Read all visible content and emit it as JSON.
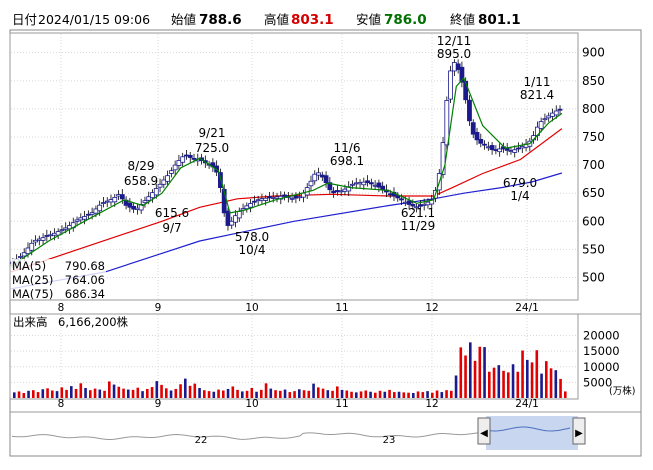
{
  "header": {
    "date_label": "日付",
    "date_value": "2024/01/15 09:06",
    "open_label": "始値",
    "open_value": "788.6",
    "high_label": "高値",
    "high_value": "803.1",
    "low_label": "安値",
    "low_value": "786.0",
    "close_label": "終値",
    "close_value": "801.1",
    "high_color": "#d40000",
    "low_color": "#007000"
  },
  "chart_data": [
    {
      "type": "candlestick",
      "title": "",
      "x_ticks": [
        "8",
        "9",
        "10",
        "11",
        "12",
        "24/1"
      ],
      "y_ticks": [
        500,
        550,
        600,
        650,
        700,
        750,
        800,
        850,
        900
      ],
      "ylim": [
        460,
        935
      ],
      "grid": true,
      "legend": [
        {
          "name": "MA(5)",
          "value": "790.68",
          "color": "#008000"
        },
        {
          "name": "MA(25)",
          "value": "764.06",
          "color": "#e00000"
        },
        {
          "name": "MA(75)",
          "value": "686.34",
          "color": "#2020d0"
        }
      ],
      "annotations": [
        {
          "label": "8/29",
          "value": "658.9"
        },
        {
          "label": "9/7",
          "value": "615.6"
        },
        {
          "label": "9/21",
          "value": "725.0"
        },
        {
          "label": "10/4",
          "value": "578.0"
        },
        {
          "label": "11/6",
          "value": "698.1"
        },
        {
          "label": "11/29",
          "value": "621.1"
        },
        {
          "label": "12/11",
          "value": "895.0"
        },
        {
          "label": "1/4",
          "value": "679.0"
        },
        {
          "label": "1/11",
          "value": "821.4"
        }
      ],
      "close_path": [
        [
          0,
          525
        ],
        [
          6,
          540
        ],
        [
          12,
          565
        ],
        [
          18,
          572
        ],
        [
          24,
          580
        ],
        [
          30,
          590
        ],
        [
          36,
          605
        ],
        [
          42,
          612
        ],
        [
          48,
          632
        ],
        [
          54,
          640
        ],
        [
          58,
          650
        ],
        [
          60,
          630
        ],
        [
          66,
          620
        ],
        [
          72,
          640
        ],
        [
          78,
          662
        ],
        [
          84,
          685
        ],
        [
          88,
          705
        ],
        [
          92,
          718
        ],
        [
          96,
          712
        ],
        [
          100,
          710
        ],
        [
          104,
          702
        ],
        [
          108,
          695
        ],
        [
          110,
          680
        ],
        [
          112,
          640
        ],
        [
          114,
          590
        ],
        [
          116,
          595
        ],
        [
          120,
          615
        ],
        [
          126,
          630
        ],
        [
          132,
          640
        ],
        [
          138,
          642
        ],
        [
          144,
          645
        ],
        [
          150,
          640
        ],
        [
          154,
          645
        ],
        [
          158,
          665
        ],
        [
          162,
          690
        ],
        [
          166,
          675
        ],
        [
          170,
          650
        ],
        [
          176,
          655
        ],
        [
          182,
          668
        ],
        [
          188,
          670
        ],
        [
          194,
          663
        ],
        [
          200,
          650
        ],
        [
          206,
          640
        ],
        [
          212,
          628
        ],
        [
          216,
          625
        ],
        [
          220,
          632
        ],
        [
          224,
          640
        ],
        [
          228,
          700
        ],
        [
          230,
          780
        ],
        [
          232,
          850
        ],
        [
          234,
          885
        ],
        [
          236,
          880
        ],
        [
          238,
          860
        ],
        [
          240,
          835
        ],
        [
          244,
          760
        ],
        [
          248,
          740
        ],
        [
          252,
          735
        ],
        [
          256,
          725
        ],
        [
          260,
          730
        ],
        [
          264,
          725
        ],
        [
          268,
          728
        ],
        [
          272,
          735
        ],
        [
          276,
          745
        ],
        [
          280,
          775
        ],
        [
          284,
          785
        ],
        [
          288,
          795
        ],
        [
          292,
          800
        ]
      ],
      "ma5_path": [
        [
          0,
          520
        ],
        [
          20,
          565
        ],
        [
          40,
          602
        ],
        [
          60,
          638
        ],
        [
          70,
          628
        ],
        [
          80,
          650
        ],
        [
          90,
          695
        ],
        [
          100,
          712
        ],
        [
          110,
          690
        ],
        [
          116,
          615
        ],
        [
          124,
          620
        ],
        [
          140,
          638
        ],
        [
          160,
          655
        ],
        [
          168,
          668
        ],
        [
          180,
          660
        ],
        [
          200,
          655
        ],
        [
          215,
          632
        ],
        [
          224,
          638
        ],
        [
          230,
          700
        ],
        [
          236,
          840
        ],
        [
          240,
          855
        ],
        [
          250,
          770
        ],
        [
          262,
          730
        ],
        [
          275,
          738
        ],
        [
          285,
          775
        ],
        [
          292,
          792
        ]
      ],
      "ma25_path": [
        [
          0,
          510
        ],
        [
          40,
          555
        ],
        [
          80,
          600
        ],
        [
          100,
          625
        ],
        [
          120,
          640
        ],
        [
          140,
          645
        ],
        [
          170,
          648
        ],
        [
          200,
          645
        ],
        [
          224,
          645
        ],
        [
          234,
          660
        ],
        [
          250,
          685
        ],
        [
          270,
          710
        ],
        [
          292,
          765
        ]
      ],
      "ma75_path": [
        [
          0,
          480
        ],
        [
          50,
          510
        ],
        [
          100,
          565
        ],
        [
          150,
          600
        ],
        [
          200,
          628
        ],
        [
          224,
          640
        ],
        [
          240,
          650
        ],
        [
          260,
          660
        ],
        [
          276,
          670
        ],
        [
          292,
          686
        ]
      ]
    },
    {
      "type": "bar",
      "title": "出来高",
      "subtitle": "6,166,200株",
      "unit": "(万株)",
      "y_ticks": [
        5000,
        10000,
        15000,
        20000
      ],
      "ylim": [
        0,
        24000
      ],
      "x_ticks": [
        "8",
        "9",
        "10",
        "11",
        "12",
        "24/1"
      ],
      "values": [
        [
          0,
          1800
        ],
        [
          1,
          2100
        ],
        [
          2,
          1600
        ],
        [
          3,
          2300
        ],
        [
          4,
          2500
        ],
        [
          5,
          1900
        ],
        [
          6,
          2800
        ],
        [
          7,
          3100
        ],
        [
          8,
          2400
        ],
        [
          9,
          2200
        ],
        [
          10,
          3400
        ],
        [
          11,
          2600
        ],
        [
          12,
          3800
        ],
        [
          13,
          2900
        ],
        [
          14,
          4700
        ],
        [
          15,
          3200
        ],
        [
          16,
          2500
        ],
        [
          17,
          3000
        ],
        [
          18,
          2700
        ],
        [
          19,
          2300
        ],
        [
          20,
          5300
        ],
        [
          21,
          4300
        ],
        [
          22,
          3600
        ],
        [
          23,
          3000
        ],
        [
          24,
          2700
        ],
        [
          25,
          2600
        ],
        [
          26,
          3300
        ],
        [
          27,
          2200
        ],
        [
          28,
          2900
        ],
        [
          29,
          3500
        ],
        [
          30,
          5400
        ],
        [
          31,
          4200
        ],
        [
          32,
          3100
        ],
        [
          33,
          2400
        ],
        [
          34,
          2900
        ],
        [
          35,
          4400
        ],
        [
          36,
          6200
        ],
        [
          37,
          3900
        ],
        [
          38,
          4600
        ],
        [
          39,
          3200
        ],
        [
          40,
          2500
        ],
        [
          41,
          2200
        ],
        [
          42,
          2000
        ],
        [
          43,
          2700
        ],
        [
          44,
          2400
        ],
        [
          45,
          2900
        ],
        [
          46,
          3700
        ],
        [
          47,
          2600
        ],
        [
          48,
          2100
        ],
        [
          49,
          2300
        ],
        [
          50,
          3200
        ],
        [
          51,
          2000
        ],
        [
          52,
          2600
        ],
        [
          53,
          4700
        ],
        [
          54,
          3000
        ],
        [
          55,
          2500
        ],
        [
          56,
          2300
        ],
        [
          57,
          2700
        ],
        [
          58,
          1900
        ],
        [
          59,
          2200
        ],
        [
          60,
          2800
        ],
        [
          61,
          2500
        ],
        [
          62,
          2300
        ],
        [
          63,
          4600
        ],
        [
          64,
          3400
        ],
        [
          65,
          3000
        ],
        [
          66,
          2500
        ],
        [
          67,
          2300
        ],
        [
          68,
          3700
        ],
        [
          69,
          2600
        ],
        [
          70,
          2400
        ],
        [
          71,
          2000
        ],
        [
          72,
          1800
        ],
        [
          73,
          2100
        ],
        [
          74,
          2400
        ],
        [
          75,
          2000
        ],
        [
          76,
          1700
        ],
        [
          77,
          2300
        ],
        [
          78,
          2000
        ],
        [
          79,
          2600
        ],
        [
          80,
          1900
        ],
        [
          81,
          2000
        ],
        [
          82,
          1800
        ],
        [
          83,
          1700
        ],
        [
          84,
          1600
        ],
        [
          85,
          2100
        ],
        [
          86,
          1900
        ],
        [
          87,
          2200
        ],
        [
          88,
          1700
        ],
        [
          89,
          2400
        ],
        [
          90,
          1900
        ],
        [
          91,
          2500
        ],
        [
          92,
          2300
        ],
        [
          93,
          7200
        ],
        [
          94,
          16200
        ],
        [
          95,
          13600
        ],
        [
          96,
          17800
        ],
        [
          97,
          11900
        ],
        [
          98,
          16400
        ],
        [
          99,
          16300
        ],
        [
          100,
          8400
        ],
        [
          101,
          9700
        ],
        [
          102,
          10500
        ],
        [
          103,
          8700
        ],
        [
          104,
          8200
        ],
        [
          105,
          10800
        ],
        [
          106,
          8400
        ],
        [
          107,
          15200
        ],
        [
          108,
          12200
        ],
        [
          109,
          11400
        ],
        [
          110,
          15300
        ],
        [
          111,
          7800
        ],
        [
          112,
          11800
        ],
        [
          113,
          9500
        ],
        [
          114,
          8900
        ],
        [
          115,
          6100
        ],
        [
          116,
          2100
        ]
      ]
    }
  ],
  "navigator": {
    "labels": [
      "22",
      "23"
    ],
    "left_handle": "◀",
    "right_handle": "▶"
  }
}
